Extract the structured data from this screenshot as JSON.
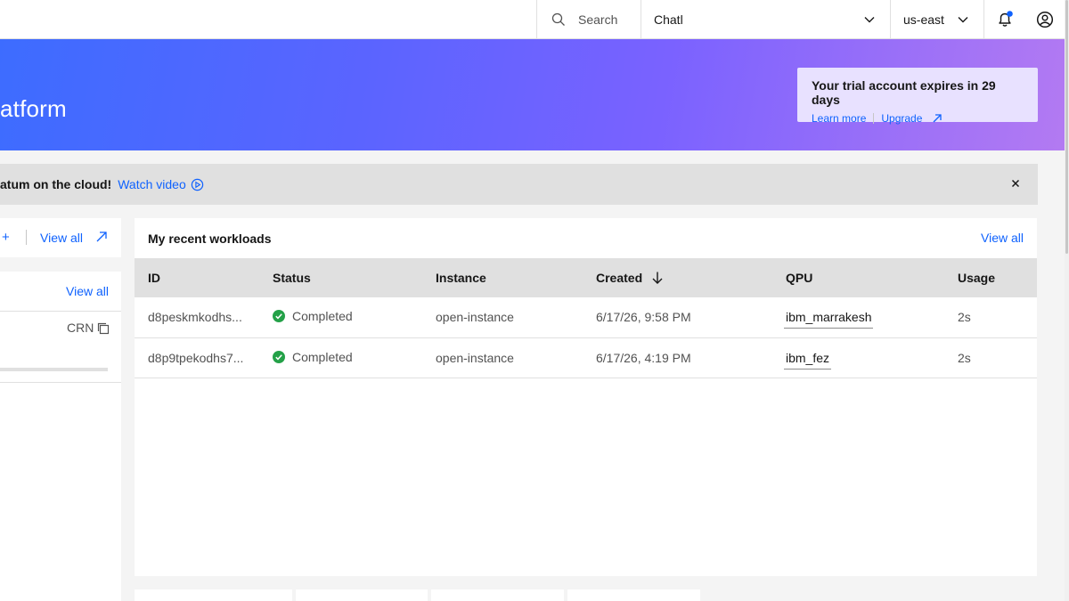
{
  "topbar": {
    "search_label": "Search",
    "account_label": "Chatl",
    "region_label": "us-east"
  },
  "hero": {
    "title": "atform",
    "trial": {
      "title": "Your trial account expires in 29 days",
      "learn_more": "Learn more",
      "upgrade": "Upgrade"
    }
  },
  "banner": {
    "text": "atum on the cloud!",
    "link": "Watch video"
  },
  "left": {
    "card1": {
      "plus": "+",
      "view_all": "View all"
    },
    "card2": {
      "view_all": "View all",
      "crn_label": "CRN"
    }
  },
  "workloads": {
    "title": "My recent workloads",
    "view_all": "View all",
    "columns": [
      "ID",
      "Status",
      "Instance",
      "Created",
      "QPU",
      "Usage"
    ],
    "rows": [
      {
        "id": "d8peskmkodhs...",
        "status": "Completed",
        "instance": "open-instance",
        "created": "6/17/26, 9:58 PM",
        "qpu": "ibm_marrakesh",
        "usage": "2s"
      },
      {
        "id": "d8p9tpekodhs7...",
        "status": "Completed",
        "instance": "open-instance",
        "created": "6/17/26, 4:19 PM",
        "qpu": "ibm_fez",
        "usage": "2s"
      }
    ]
  },
  "colors": {
    "accent": "#0f62fe",
    "success": "#24a148",
    "notification_dot": "#0f62fe"
  }
}
